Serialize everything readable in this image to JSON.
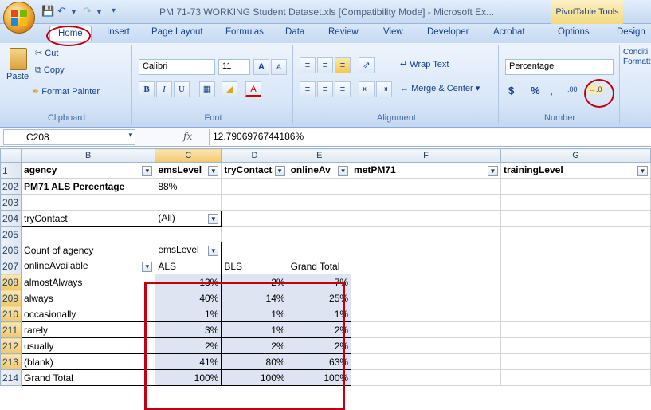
{
  "window": {
    "title": "PM 71-73 WORKING Student Dataset.xls  [Compatibility Mode] - Microsoft Ex...",
    "context_tab": "PivotTable Tools"
  },
  "tabs": [
    "Home",
    "Insert",
    "Page Layout",
    "Formulas",
    "Data",
    "Review",
    "View",
    "Developer",
    "Acrobat",
    "Options",
    "Design"
  ],
  "ribbon": {
    "clipboard": {
      "paste": "Paste",
      "cut": "Cut",
      "copy": "Copy",
      "format_painter": "Format Painter",
      "label": "Clipboard"
    },
    "font": {
      "name": "Calibri",
      "size": "11",
      "label": "Font",
      "bold": "B",
      "italic": "I",
      "underline": "U",
      "grow": "A",
      "shrink": "A",
      "color": "A"
    },
    "alignment": {
      "wrap": "Wrap Text",
      "merge": "Merge & Center",
      "label": "Alignment"
    },
    "number": {
      "format": "Percentage",
      "currency": "$",
      "percent": "%",
      "comma": ",",
      "inc_decimal": ".00",
      "dec_decimal": "→.0",
      "label": "Number"
    },
    "cond": "Conditi Formatti"
  },
  "formula_bar": {
    "cell": "C208",
    "fx": "fx",
    "value": "12.7906976744186%"
  },
  "columns": [
    "B",
    "C",
    "D",
    "E",
    "F",
    "G"
  ],
  "header_row": {
    "num": "1",
    "cells": [
      "agency",
      "emsLevel",
      "tryContact",
      "onlineAv",
      "metPM71",
      "trainingLevel"
    ]
  },
  "rows": [
    {
      "num": "202",
      "b": "PM71  ALS Percentage",
      "c": "88%",
      "d": "",
      "e": ""
    },
    {
      "num": "203",
      "b": "",
      "c": "",
      "d": "",
      "e": ""
    },
    {
      "num": "204",
      "b": "tryContact",
      "c": "(All)",
      "d": "",
      "e": ""
    },
    {
      "num": "205",
      "b": "",
      "c": "",
      "d": "",
      "e": ""
    },
    {
      "num": "206",
      "b": "Count of agency",
      "c": "emsLevel",
      "d": "",
      "e": ""
    },
    {
      "num": "207",
      "b": "onlineAvailable",
      "c": "ALS",
      "d": "BLS",
      "e": "Grand Total"
    },
    {
      "num": "208",
      "b": "almostAlways",
      "c": "13%",
      "d": "2%",
      "e": "7%"
    },
    {
      "num": "209",
      "b": "always",
      "c": "40%",
      "d": "14%",
      "e": "25%"
    },
    {
      "num": "210",
      "b": "occasionally",
      "c": "1%",
      "d": "1%",
      "e": "1%"
    },
    {
      "num": "211",
      "b": "rarely",
      "c": "3%",
      "d": "1%",
      "e": "2%"
    },
    {
      "num": "212",
      "b": "usually",
      "c": "2%",
      "d": "2%",
      "e": "2%"
    },
    {
      "num": "213",
      "b": "(blank)",
      "c": "41%",
      "d": "80%",
      "e": "63%"
    },
    {
      "num": "214",
      "b": "Grand Total",
      "c": "100%",
      "d": "100%",
      "e": "100%"
    }
  ],
  "colors": {
    "annotation": "#c00010",
    "selected_header": "#f0c868",
    "pivot_shade": "#dfe4f2"
  }
}
